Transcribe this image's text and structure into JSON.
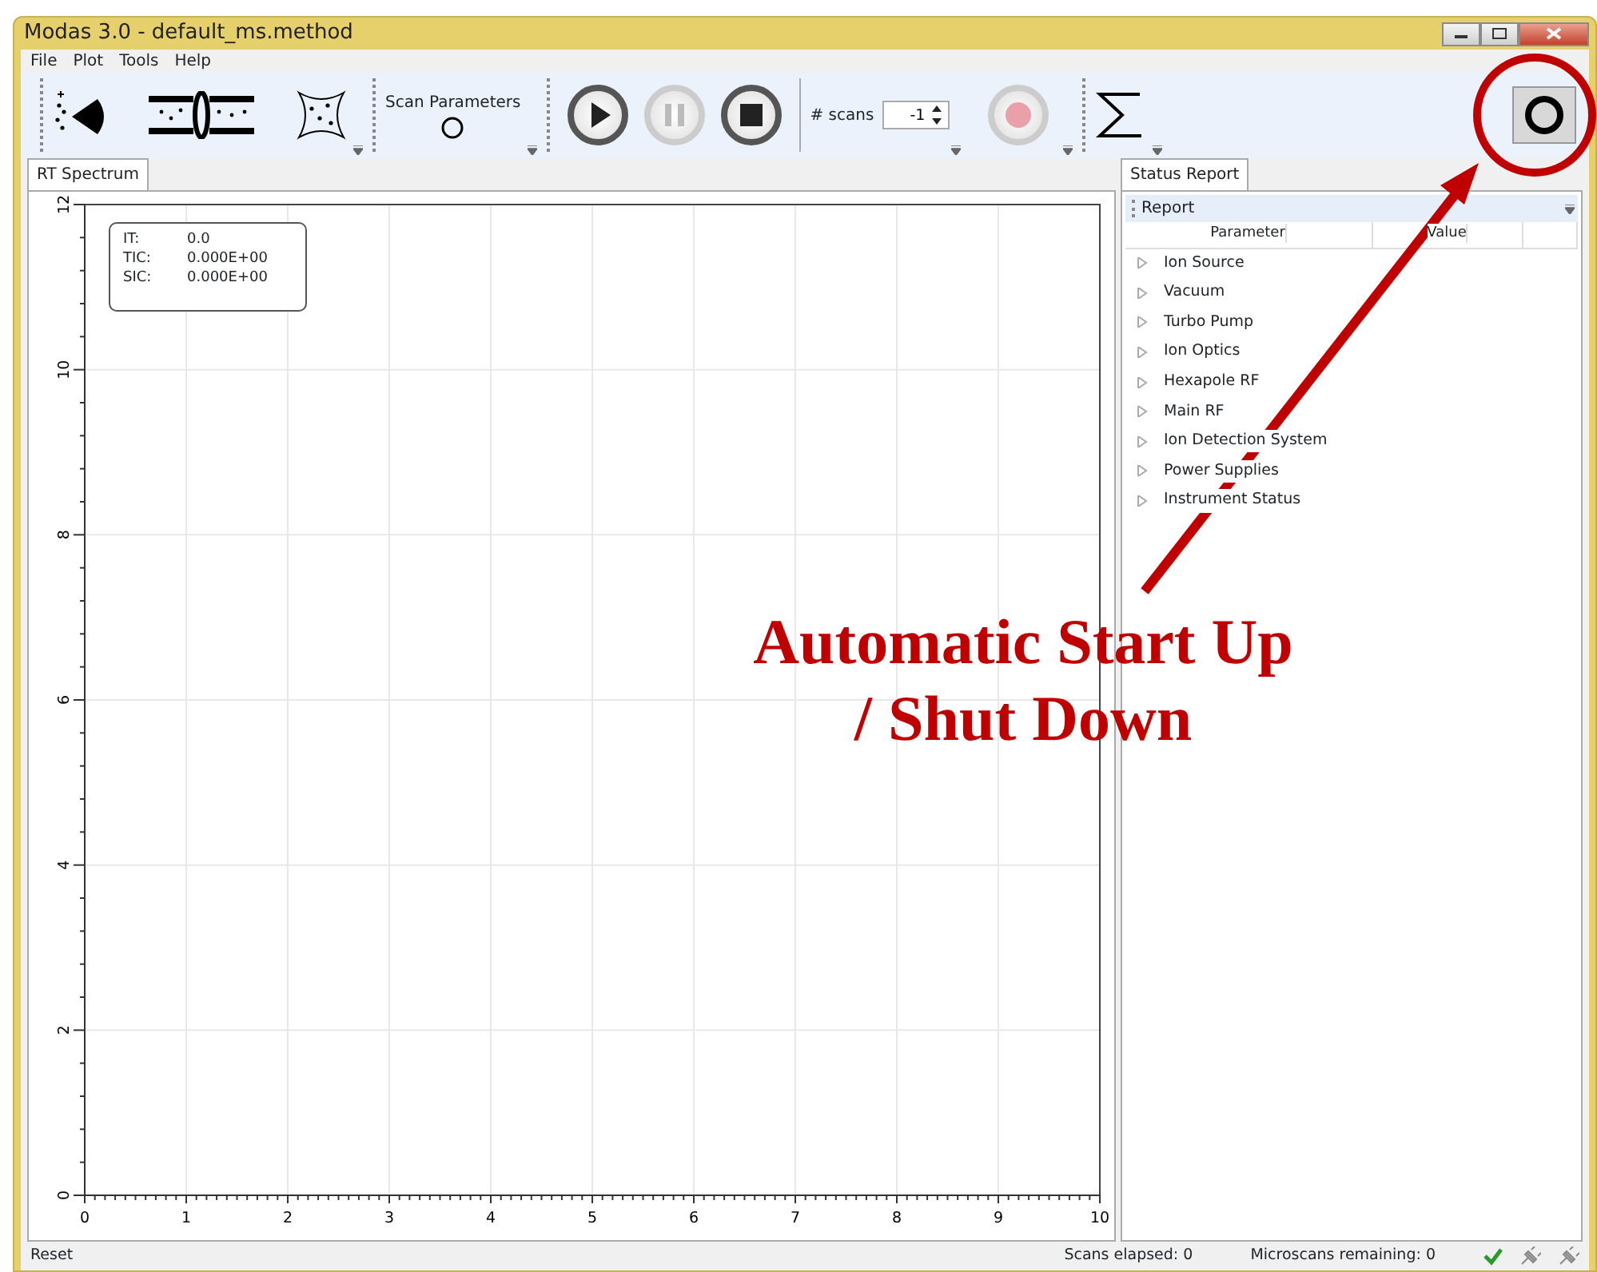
{
  "window": {
    "title": "Modas 3.0 - default_ms.method"
  },
  "menu": [
    "File",
    "Plot",
    "Tools",
    "Help"
  ],
  "toolbar": {
    "scan_parameters": "Scan Parameters",
    "playback": [
      {
        "kind": "play",
        "disabled": false
      },
      {
        "kind": "pause",
        "disabled": true
      },
      {
        "kind": "stop",
        "disabled": false
      }
    ],
    "scans": {
      "label": "# scans",
      "value": "-1"
    },
    "record": {
      "disabled": true
    }
  },
  "left_panel": {
    "tabs": [
      {
        "label": "RT Spectrum",
        "selected": true
      }
    ],
    "readout": [
      {
        "label": "IT:",
        "value": "0.0"
      },
      {
        "label": "TIC:",
        "value": "0.000E+00"
      },
      {
        "label": "SIC:",
        "value": "0.000E+00"
      }
    ],
    "chart_data": {
      "type": "line",
      "grid": true,
      "xlim": [
        0,
        10
      ],
      "ylim": [
        0,
        12
      ],
      "xticks": [
        0,
        1,
        2,
        3,
        4,
        5,
        6,
        7,
        8,
        9,
        10
      ],
      "yticks": [
        0,
        2,
        4,
        6,
        8,
        10,
        12
      ]
    }
  },
  "right_panel": {
    "tabs": [
      {
        "label": "Status Report",
        "selected": true
      }
    ],
    "toolbar_label": "Report",
    "columns": [
      "Parameter",
      "Value"
    ],
    "rows": [
      {
        "label": "Ion Source",
        "expanded": false
      },
      {
        "label": "Vacuum",
        "expanded": false
      },
      {
        "label": "Turbo Pump",
        "expanded": false
      },
      {
        "label": "Ion Optics",
        "expanded": false
      },
      {
        "label": "Hexapole RF",
        "expanded": false
      },
      {
        "label": "Main RF",
        "expanded": false
      },
      {
        "label": "Ion Detection System",
        "expanded": false
      },
      {
        "label": "Power Supplies",
        "expanded": false
      },
      {
        "label": "Instrument Status",
        "expanded": false
      }
    ]
  },
  "status_bar": {
    "message": "Reset",
    "scans_elapsed": "Scans elapsed: 0",
    "microscans_remaining": "Microscans remaining: 0"
  },
  "annotation": {
    "lines": [
      "Automatic Start Up",
      "/ Shut Down"
    ]
  }
}
